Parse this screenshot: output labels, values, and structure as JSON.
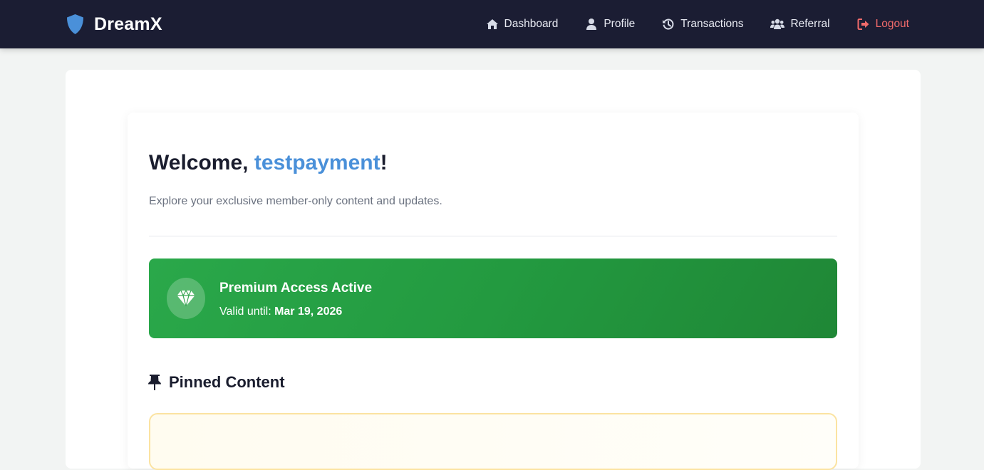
{
  "app": {
    "brand": "DreamX",
    "brand_icon": "shield-icon"
  },
  "nav": {
    "items": [
      {
        "label": "Dashboard",
        "icon": "home-icon"
      },
      {
        "label": "Profile",
        "icon": "user-icon"
      },
      {
        "label": "Transactions",
        "icon": "history-icon"
      },
      {
        "label": "Referral",
        "icon": "users-icon"
      },
      {
        "label": "Logout",
        "icon": "logout-icon"
      }
    ]
  },
  "welcome": {
    "prefix": "Welcome, ",
    "username": "testpayment",
    "suffix": "!",
    "subtitle": "Explore your exclusive member-only content and updates."
  },
  "premium": {
    "icon": "diamond-icon",
    "title": "Premium Access Active",
    "valid_label": "Valid until: ",
    "valid_date": "Mar 19, 2026"
  },
  "pinned": {
    "icon": "pin-icon",
    "title": "Pinned Content"
  },
  "colors": {
    "navbar": "#1b1d33",
    "accent": "#4a90d9",
    "logout": "#f26b6b",
    "premium_green": "#28a745",
    "pinned_border": "#fbe3a1"
  }
}
